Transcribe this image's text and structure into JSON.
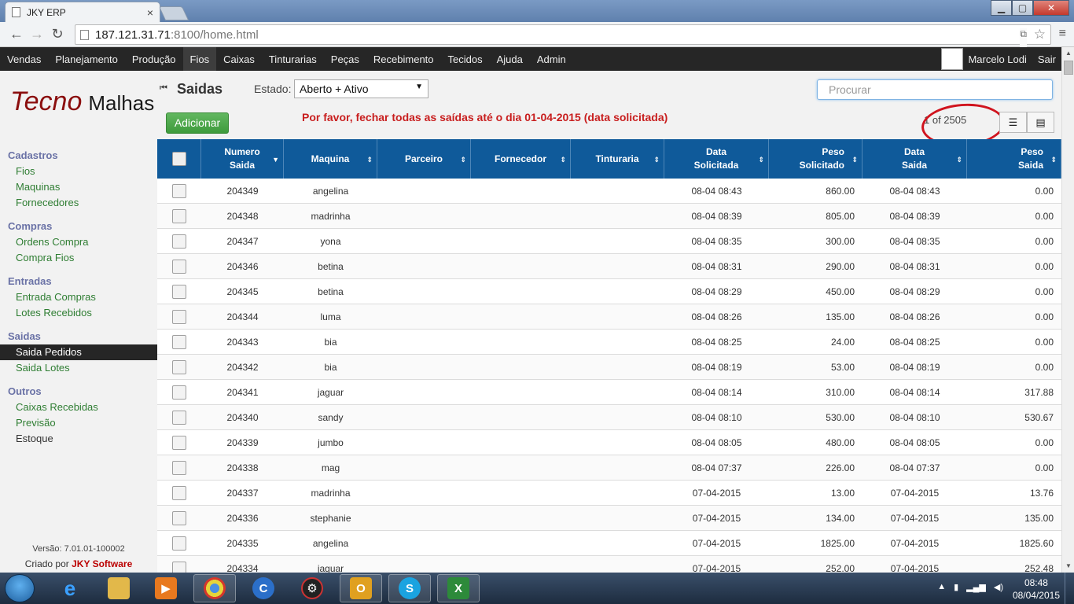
{
  "browser": {
    "tab_title": "JKY ERP",
    "tab_close": "×",
    "url_host": "187.121.31.71",
    "url_path": ":8100/home.html",
    "win_min": "▁",
    "win_max": "▢",
    "win_close": "✕"
  },
  "appnav": {
    "items": [
      "Vendas",
      "Planejamento",
      "Produção",
      "Fios",
      "Caixas",
      "Tinturarias",
      "Peças",
      "Recebimento",
      "Tecidos",
      "Ajuda",
      "Admin"
    ],
    "active": "Fios",
    "user_name": "Marcelo Lodi",
    "logout": "Sair"
  },
  "logo": {
    "part1": "Tecno",
    "part2": "Malhas"
  },
  "sidebar": {
    "groups": [
      {
        "title": "Cadastros",
        "items": [
          "Fios",
          "Maquinas",
          "Fornecedores"
        ]
      },
      {
        "title": "Compras",
        "items": [
          "Ordens Compra",
          "Compra Fios"
        ]
      },
      {
        "title": "Entradas",
        "items": [
          "Entrada Compras",
          "Lotes Recebidos"
        ]
      },
      {
        "title": "Saidas",
        "items": [
          "Saida Pedidos",
          "Saida Lotes"
        ]
      },
      {
        "title": "Outros",
        "items": [
          "Caixas Recebidas",
          "Previsão",
          "Estoque"
        ]
      }
    ],
    "selected": "Saida Pedidos",
    "version": "Versão: 7.01.01-100002",
    "credit_prefix": "Criado por",
    "credit_name": "JKY Software"
  },
  "main": {
    "collapse_icon": "⏮",
    "title": "Saidas",
    "estado_label": "Estado:",
    "estado_value": "Aberto + Ativo",
    "search_placeholder": "Procurar",
    "add_label": "Adicionar",
    "notice": "Por favor, fechar todas as saídas até o dia 01-04-2015 (data solicitada)",
    "pager": "1 of 2505",
    "highlight_color": "#d0141e"
  },
  "table": {
    "headers": [
      {
        "l1": "Numero",
        "l2": "Saida"
      },
      {
        "l1": "Maquina",
        "l2": ""
      },
      {
        "l1": "Parceiro",
        "l2": ""
      },
      {
        "l1": "Fornecedor",
        "l2": ""
      },
      {
        "l1": "Tinturaria",
        "l2": ""
      },
      {
        "l1": "Data",
        "l2": "Solicitada"
      },
      {
        "l1": "Peso",
        "l2": "Solicitado"
      },
      {
        "l1": "Data",
        "l2": "Saida"
      },
      {
        "l1": "Peso",
        "l2": "Saida"
      }
    ],
    "rows": [
      [
        "204349",
        "angelina",
        "",
        "",
        "",
        "08-04 08:43",
        "860.00",
        "08-04 08:43",
        "0.00"
      ],
      [
        "204348",
        "madrinha",
        "",
        "",
        "",
        "08-04 08:39",
        "805.00",
        "08-04 08:39",
        "0.00"
      ],
      [
        "204347",
        "yona",
        "",
        "",
        "",
        "08-04 08:35",
        "300.00",
        "08-04 08:35",
        "0.00"
      ],
      [
        "204346",
        "betina",
        "",
        "",
        "",
        "08-04 08:31",
        "290.00",
        "08-04 08:31",
        "0.00"
      ],
      [
        "204345",
        "betina",
        "",
        "",
        "",
        "08-04 08:29",
        "450.00",
        "08-04 08:29",
        "0.00"
      ],
      [
        "204344",
        "luma",
        "",
        "",
        "",
        "08-04 08:26",
        "135.00",
        "08-04 08:26",
        "0.00"
      ],
      [
        "204343",
        "bia",
        "",
        "",
        "",
        "08-04 08:25",
        "24.00",
        "08-04 08:25",
        "0.00"
      ],
      [
        "204342",
        "bia",
        "",
        "",
        "",
        "08-04 08:19",
        "53.00",
        "08-04 08:19",
        "0.00"
      ],
      [
        "204341",
        "jaguar",
        "",
        "",
        "",
        "08-04 08:14",
        "310.00",
        "08-04 08:14",
        "317.88"
      ],
      [
        "204340",
        "sandy",
        "",
        "",
        "",
        "08-04 08:10",
        "530.00",
        "08-04 08:10",
        "530.67"
      ],
      [
        "204339",
        "jumbo",
        "",
        "",
        "",
        "08-04 08:05",
        "480.00",
        "08-04 08:05",
        "0.00"
      ],
      [
        "204338",
        "mag",
        "",
        "",
        "",
        "08-04 07:37",
        "226.00",
        "08-04 07:37",
        "0.00"
      ],
      [
        "204337",
        "madrinha",
        "",
        "",
        "",
        "07-04-2015",
        "13.00",
        "07-04-2015",
        "13.76"
      ],
      [
        "204336",
        "stephanie",
        "",
        "",
        "",
        "07-04-2015",
        "134.00",
        "07-04-2015",
        "135.00"
      ],
      [
        "204335",
        "angelina",
        "",
        "",
        "",
        "07-04-2015",
        "1825.00",
        "07-04-2015",
        "1825.60"
      ],
      [
        "204334",
        "jaguar",
        "",
        "",
        "",
        "07-04-2015",
        "252.00",
        "07-04-2015",
        "252.48"
      ]
    ]
  },
  "taskbar": {
    "time": "08:48",
    "date": "08/04/2015",
    "apps": [
      "ie-icon",
      "explorer-icon",
      "media-player-icon",
      "chrome-icon",
      "ccleaner-icon",
      "app-icon",
      "outlook-icon",
      "skype-icon",
      "excel-icon"
    ]
  }
}
